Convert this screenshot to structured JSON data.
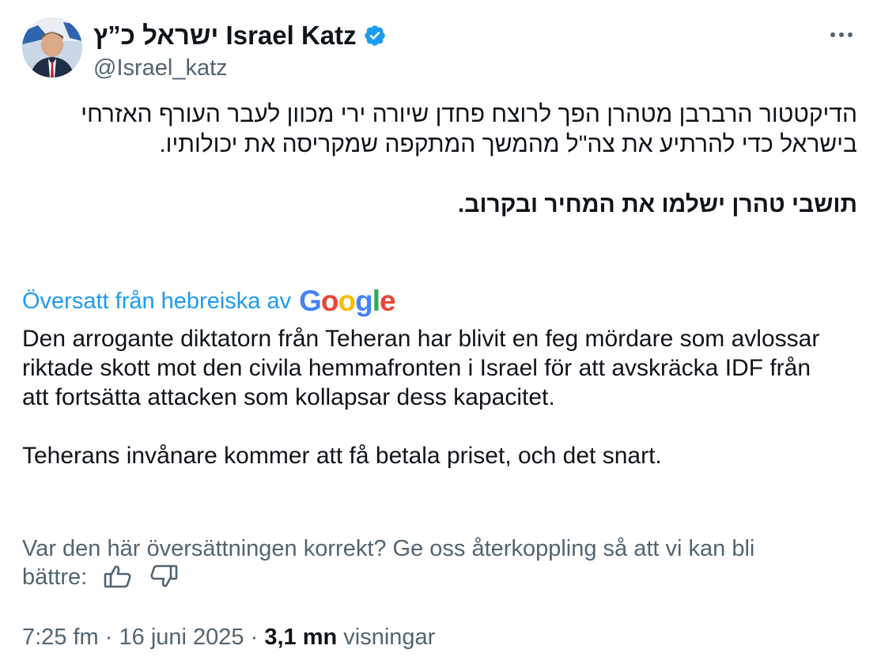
{
  "author": {
    "display_name": "ישראל כ”ץ Israel Katz",
    "handle": "@Israel_katz",
    "verified_color": "#1d9bf0"
  },
  "tweet": {
    "hebrew_paragraph": "הדיקטטור הרברבן מטהרן הפך לרוצח פחדן שיורה ירי מכוון לעבר העורף האזרחי בישראל כדי להרתיע את צה\"ל מהמשך המתקפה שמקריסה את יכולותיו.",
    "hebrew_bold": "תושבי טהרן ישלמו את המחיר ובקרוב."
  },
  "translation": {
    "label": "Översatt från hebreiska av",
    "provider": "Google",
    "paragraph_1": "Den arrogante diktatorn från Teheran har blivit en feg mördare som avlossar riktade skott mot den civila hemmafronten i Israel för att avskräcka IDF från att fortsätta attacken som kollapsar dess kapacitet.",
    "paragraph_2": "Teherans invånare kommer att få betala priset, och det snart."
  },
  "feedback": {
    "text": "Var den här översättningen korrekt? Ge oss återkoppling så att vi kan bli bättre:"
  },
  "meta": {
    "time": "7:25 fm",
    "separator": "·",
    "date": "16 juni 2025",
    "views_count": "3,1 mn",
    "views_label": "visningar"
  },
  "colors": {
    "text": "#0f1419",
    "secondary": "#536471",
    "link": "#1d9bf0"
  },
  "icons": [
    "verified-badge-icon",
    "more-options-icon",
    "thumbs-up-icon",
    "thumbs-down-icon"
  ]
}
